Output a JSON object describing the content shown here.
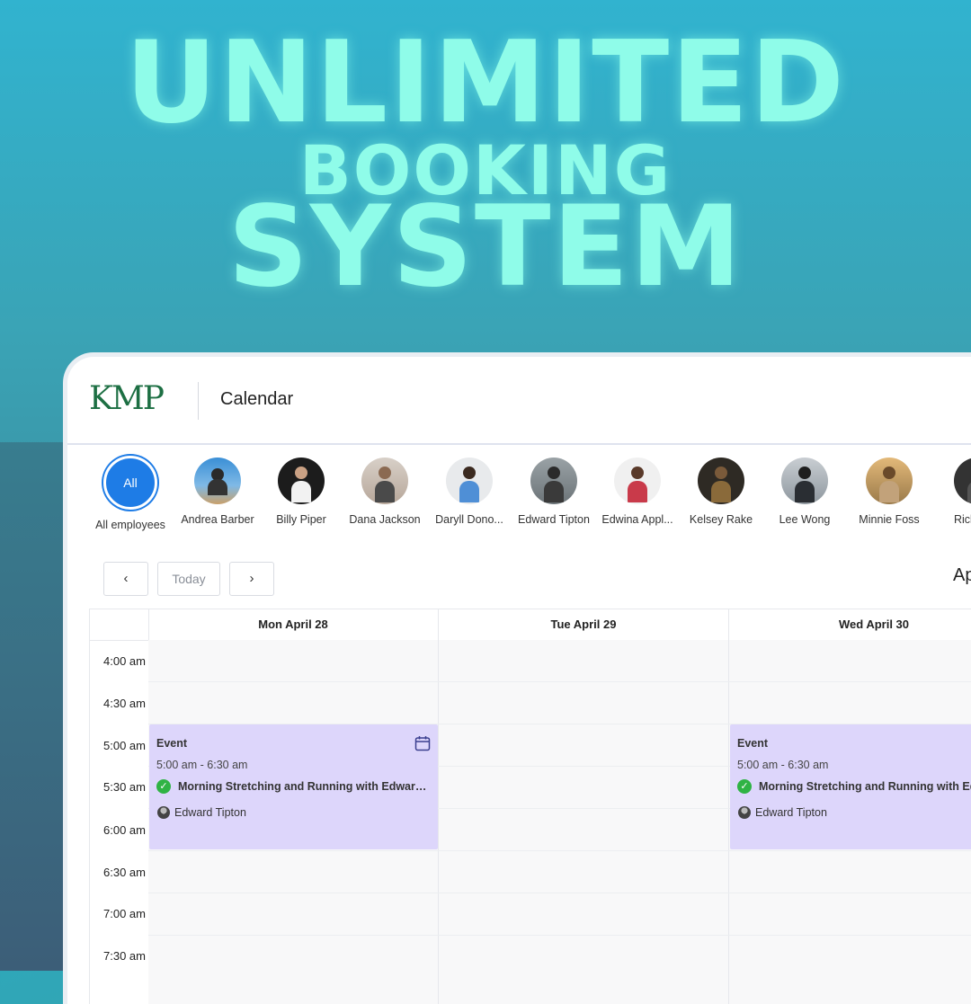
{
  "headline": {
    "line1": "UNLIMITED",
    "line2": "BOOKING",
    "line3": "SYSTEM"
  },
  "header": {
    "logo_text": "KMP",
    "title": "Calendar"
  },
  "employees": [
    {
      "name": "All employees",
      "avatar_label": "All"
    },
    {
      "name": "Andrea Barber"
    },
    {
      "name": "Billy Piper"
    },
    {
      "name": "Dana Jackson"
    },
    {
      "name": "Daryll Dono..."
    },
    {
      "name": "Edward Tipton"
    },
    {
      "name": "Edwina Appl..."
    },
    {
      "name": "Kelsey Rake"
    },
    {
      "name": "Lee Wong"
    },
    {
      "name": "Minnie Foss"
    },
    {
      "name": "Ricky F"
    }
  ],
  "nav": {
    "prev_icon": "‹",
    "today_label": "Today",
    "next_icon": "›",
    "month_label_partial": "Ap"
  },
  "days": [
    {
      "label": "Mon April 28"
    },
    {
      "label": "Tue April 29"
    },
    {
      "label": "Wed April 30"
    }
  ],
  "times": [
    "4:00 am",
    "4:30 am",
    "5:00 am",
    "5:30 am",
    "6:00 am",
    "6:30 am",
    "7:00 am",
    "7:30 am"
  ],
  "events": [
    {
      "type": "Event",
      "time": "5:00 am - 6:30 am",
      "title": "Morning Stretching and Running with Edward ...",
      "employee": "Edward Tipton"
    },
    {
      "type": "Event",
      "time": "5:00 am - 6:30 am",
      "title": "Morning Stretching and Running with Ed",
      "employee": "Edward Tipton"
    }
  ],
  "colors": {
    "accent": "#1e7ce6",
    "event_bg": "#ddd6fb",
    "status_ok": "#2fb344",
    "headline": "#8ffce9"
  }
}
